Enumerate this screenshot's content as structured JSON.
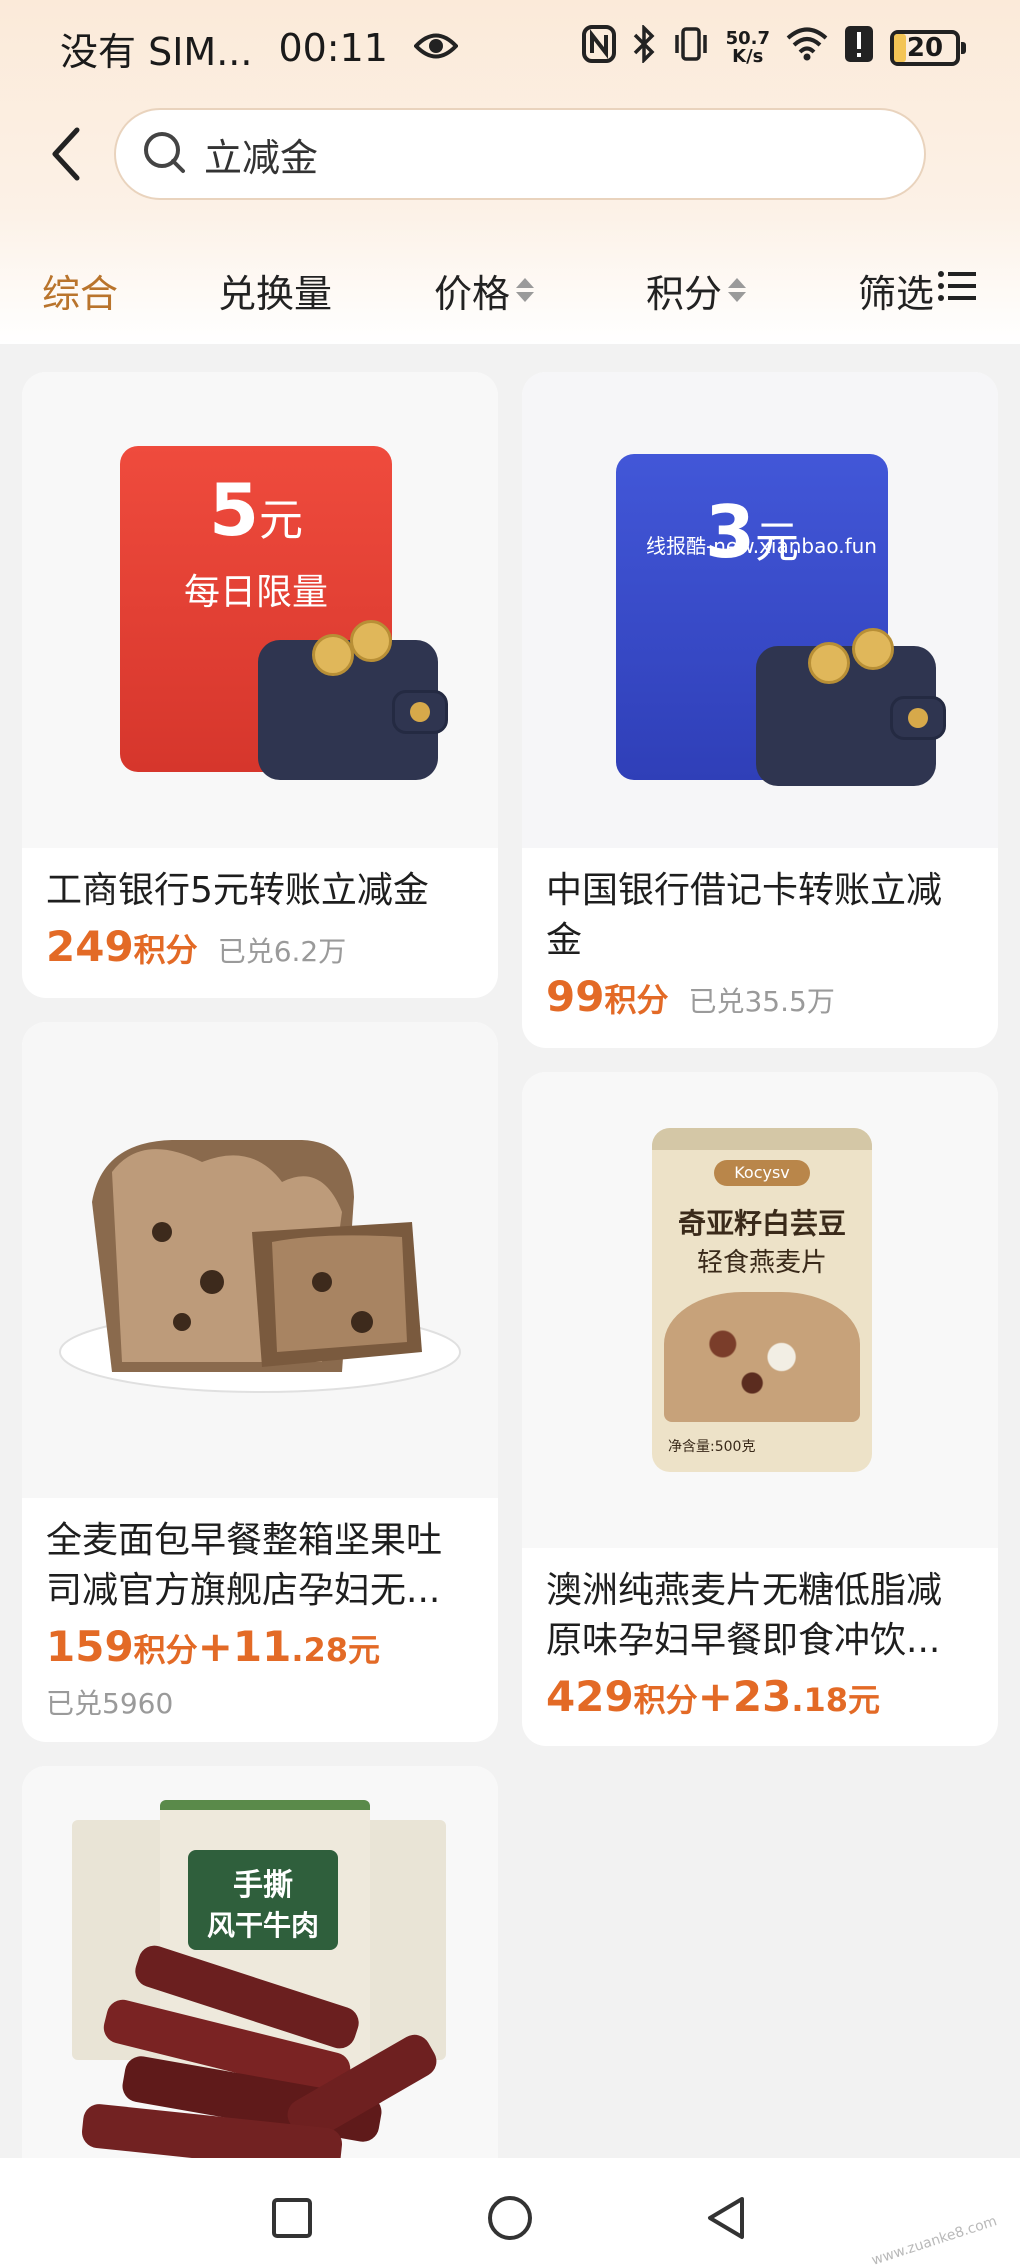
{
  "status_bar": {
    "carrier": "没有 SIM...",
    "time": "00:11",
    "net_speed_value": "50.7",
    "net_speed_unit": "K/s",
    "battery_level": "20",
    "battery_fraction": 0.2
  },
  "search": {
    "query": "立减金"
  },
  "tabs": [
    {
      "label": "综合",
      "active": true
    },
    {
      "label": "兑换量",
      "active": false
    },
    {
      "label": "价格",
      "active": false,
      "sortable": true
    },
    {
      "label": "积分",
      "active": false,
      "sortable": true
    },
    {
      "label": "筛选",
      "active": false,
      "filter": true
    }
  ],
  "products": [
    {
      "title": "工商银行5元转账立减金",
      "price_points": "249",
      "points_unit": "积分",
      "sold": "已兑6.2万",
      "image": {
        "amount": "5",
        "unit": "元",
        "subtitle": "每日限量",
        "color": "#e24a3d"
      }
    },
    {
      "title": "中国银行借记卡转账立减金",
      "price_points": "99",
      "points_unit": "积分",
      "sold": "已兑35.5万",
      "image": {
        "amount": "3",
        "unit": "元",
        "watermark": "线报酷-new.xianbao.fun",
        "color": "#3a4fd1"
      }
    },
    {
      "title": "全麦面包早餐整箱坚果吐司减官方旗舰店孕妇无...",
      "price_points": "159",
      "points_unit": "积分",
      "plus_cash": "+11",
      "cash_decimal": ".28元",
      "sold": "已兑5960"
    },
    {
      "title": "澳洲纯燕麦片无糖低脂减原味孕妇早餐即食冲饮...",
      "price_points": "429",
      "points_unit": "积分",
      "plus_cash": "+23",
      "cash_decimal": ".18元",
      "image": {
        "brand": "Kocysv",
        "line1": "奇亚籽白芸豆",
        "line2": "轻食燕麦片",
        "weight": "净含量:500克"
      }
    },
    {
      "title": "",
      "image": {
        "line1": "手撕",
        "line2": "风干牛肉"
      }
    }
  ],
  "watermark": "www.zuanke8.com",
  "colors": {
    "accent": "#b9742c",
    "price": "#e36a26"
  }
}
